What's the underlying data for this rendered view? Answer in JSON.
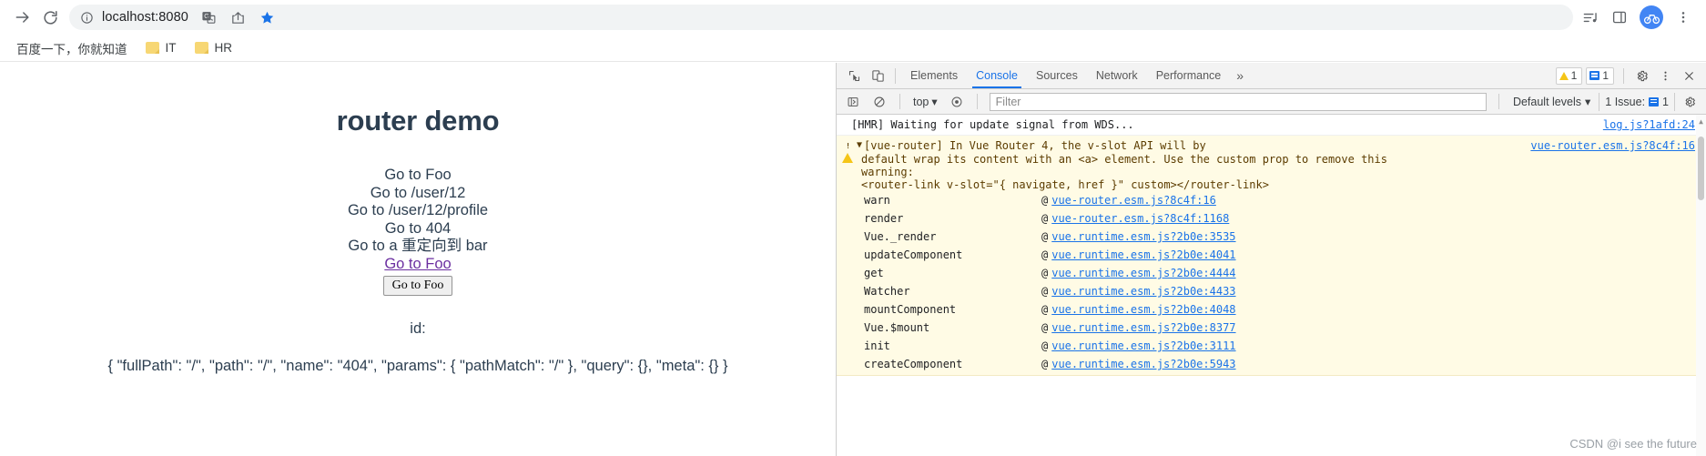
{
  "browser": {
    "forward_label": "→",
    "reload_label": "⟳",
    "url": "localhost:8080",
    "icons": {
      "forward": "forward-arrow-icon",
      "reload": "reload-icon",
      "site_info": "site-info-icon",
      "translate": "translate-icon",
      "share": "share-icon",
      "bookmark_star": "star-filled-icon",
      "media": "media-playlist-icon",
      "side_panel": "side-panel-icon",
      "profile": "profile-avatar-icon",
      "menu": "three-dot-menu-icon"
    },
    "accent": "#1a73e8"
  },
  "bookmarks": [
    {
      "label": "百度一下，你就知道",
      "has_folder": false
    },
    {
      "label": "IT",
      "has_folder": true
    },
    {
      "label": "HR",
      "has_folder": true
    }
  ],
  "page": {
    "title": "router demo",
    "nav_lines": [
      "Go to Foo",
      "Go to /user/12",
      "Go to /user/12/profile",
      "Go to 404",
      "Go to a 重定向到 bar"
    ],
    "visited_link": "Go to Foo",
    "button": "Go to Foo",
    "id_label": "id:",
    "route_json": "{ \"fullPath\": \"/\", \"path\": \"/\", \"name\": \"404\", \"params\": { \"pathMatch\": \"/\" }, \"query\": {}, \"meta\": {} }"
  },
  "devtools": {
    "tabs": [
      {
        "label": "Elements",
        "active": false
      },
      {
        "label": "Console",
        "active": true
      },
      {
        "label": "Sources",
        "active": false
      },
      {
        "label": "Network",
        "active": false
      },
      {
        "label": "Performance",
        "active": false
      }
    ],
    "overflow_label": "»",
    "warning_count": "1",
    "message_count": "1",
    "icons": {
      "inspect": "inspect-element-icon",
      "device": "device-toolbar-icon",
      "settings": "gear-icon",
      "more": "three-dot-menu-icon",
      "close": "close-icon",
      "sidebar": "console-sidebar-icon",
      "clear": "clear-console-icon",
      "eye": "live-expression-icon"
    },
    "toolbar": {
      "context": "top",
      "context_caret": "▾",
      "filter_placeholder": "Filter",
      "filter_value": "",
      "levels": "Default levels",
      "levels_caret": "▾",
      "issues_label": "1 Issue:",
      "issues_count": "1"
    },
    "console": {
      "hmr": {
        "text": "[HMR] Waiting for update signal from WDS...",
        "source": "log.js?1afd:24"
      },
      "warning": {
        "toggle": "▼",
        "line1": "[vue-router] In Vue Router 4, the v-slot API will by",
        "line2": "default wrap its content with an <a> element. Use the custom prop to remove this",
        "line3": "warning:",
        "line4": "<router-link v-slot=\"{ navigate, href }\" custom></router-link>",
        "source": "vue-router.esm.js?8c4f:16"
      },
      "stack": [
        {
          "fn": "warn",
          "at": "@",
          "src": "vue-router.esm.js?8c4f:16"
        },
        {
          "fn": "render",
          "at": "@",
          "src": "vue-router.esm.js?8c4f:1168"
        },
        {
          "fn": "Vue._render",
          "at": "@",
          "src": "vue.runtime.esm.js?2b0e:3535"
        },
        {
          "fn": "updateComponent",
          "at": "@",
          "src": "vue.runtime.esm.js?2b0e:4041"
        },
        {
          "fn": "get",
          "at": "@",
          "src": "vue.runtime.esm.js?2b0e:4444"
        },
        {
          "fn": "Watcher",
          "at": "@",
          "src": "vue.runtime.esm.js?2b0e:4433"
        },
        {
          "fn": "mountComponent",
          "at": "@",
          "src": "vue.runtime.esm.js?2b0e:4048"
        },
        {
          "fn": "Vue.$mount",
          "at": "@",
          "src": "vue.runtime.esm.js?2b0e:8377"
        },
        {
          "fn": "init",
          "at": "@",
          "src": "vue.runtime.esm.js?2b0e:3111"
        },
        {
          "fn": "createComponent",
          "at": "@",
          "src": "vue.runtime.esm.js?2b0e:5943"
        }
      ]
    }
  },
  "watermark": "CSDN @i see the future"
}
